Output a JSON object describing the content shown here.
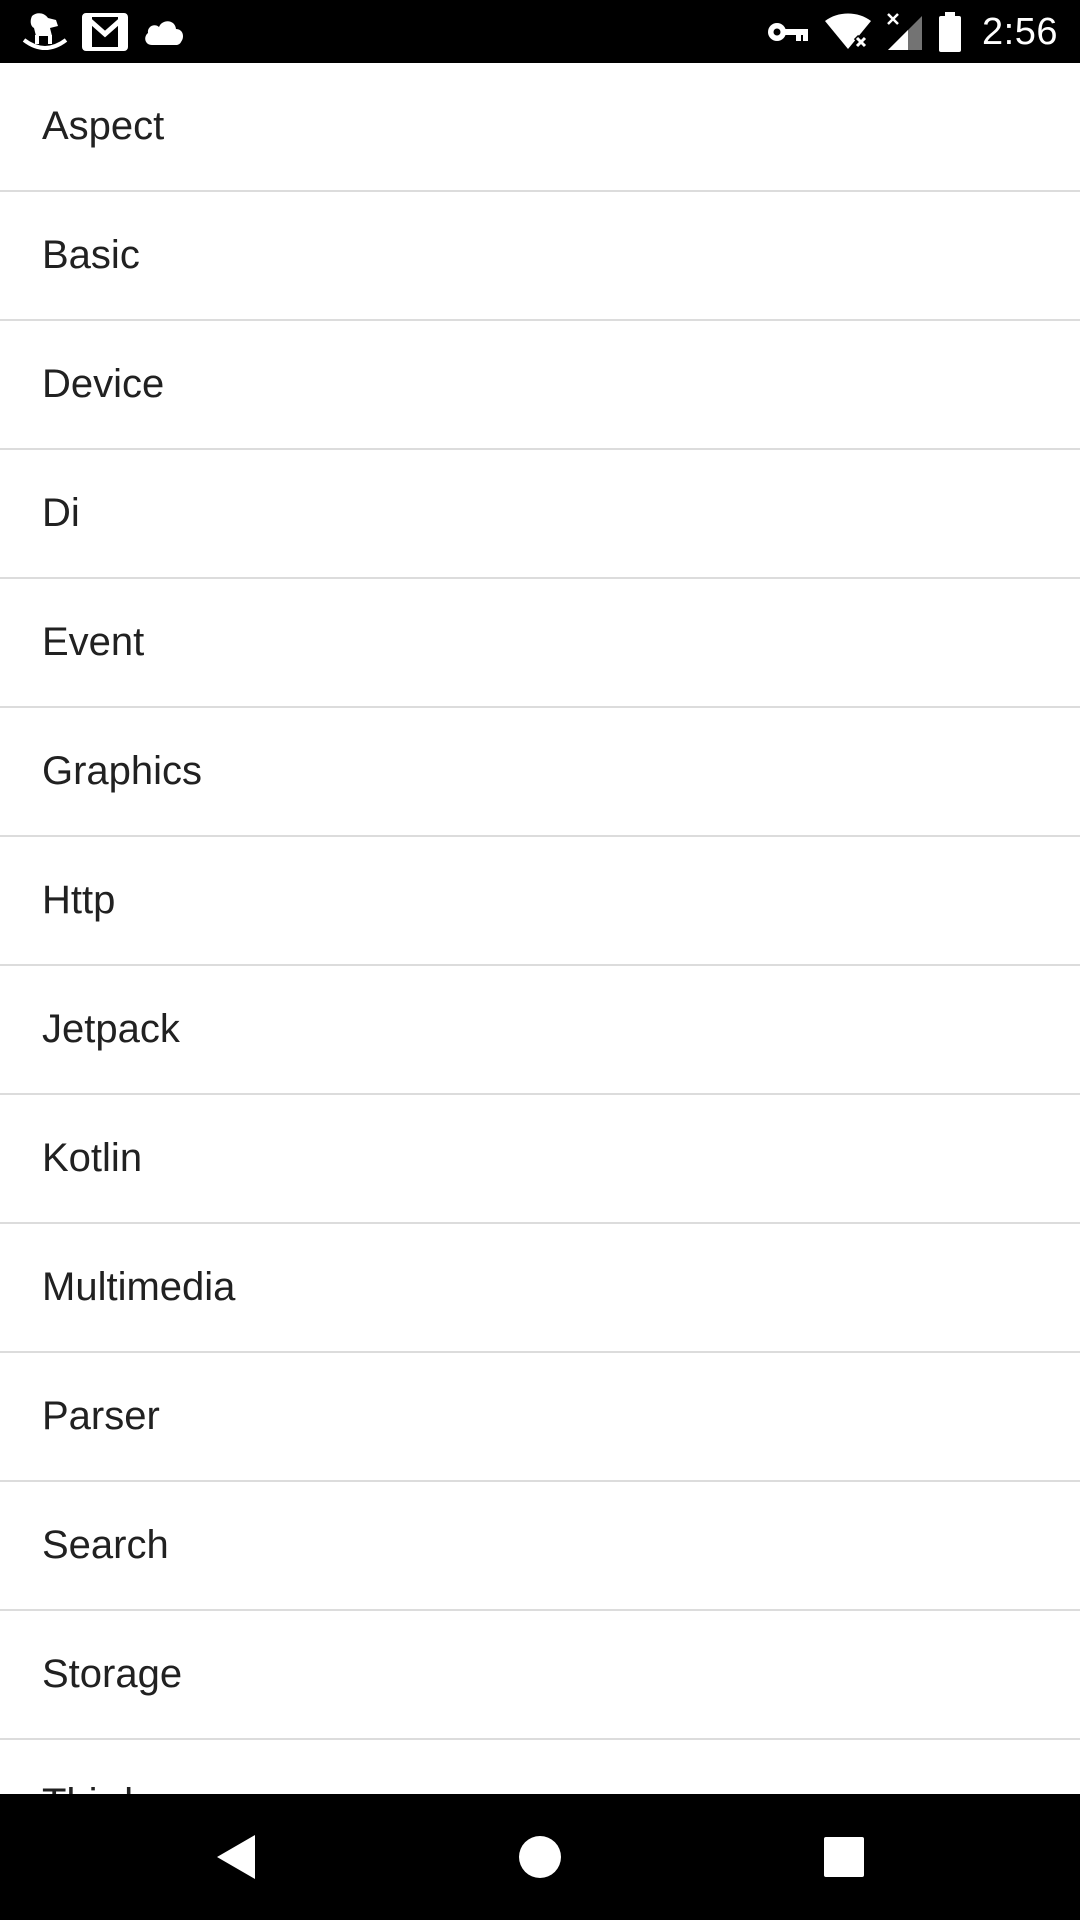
{
  "status_bar": {
    "time": "2:56",
    "left_icons": [
      "rocking-horse-icon",
      "gmail-icon",
      "cloud-icon"
    ],
    "right_icons": [
      "vpn-key-icon",
      "wifi-icon",
      "signal-icon",
      "battery-icon"
    ]
  },
  "list": {
    "items": [
      {
        "label": "Aspect"
      },
      {
        "label": "Basic"
      },
      {
        "label": "Device"
      },
      {
        "label": "Di"
      },
      {
        "label": "Event"
      },
      {
        "label": "Graphics"
      },
      {
        "label": "Http"
      },
      {
        "label": "Jetpack"
      },
      {
        "label": "Kotlin"
      },
      {
        "label": "Multimedia"
      },
      {
        "label": "Parser"
      },
      {
        "label": "Search"
      },
      {
        "label": "Storage"
      },
      {
        "label": "Third"
      }
    ]
  },
  "nav_bar": {
    "buttons": [
      "back-icon",
      "home-icon",
      "recents-icon"
    ]
  },
  "colors": {
    "bars": "#000000",
    "background": "#ffffff",
    "text": "#212121",
    "divider": "#dcdcdc"
  }
}
